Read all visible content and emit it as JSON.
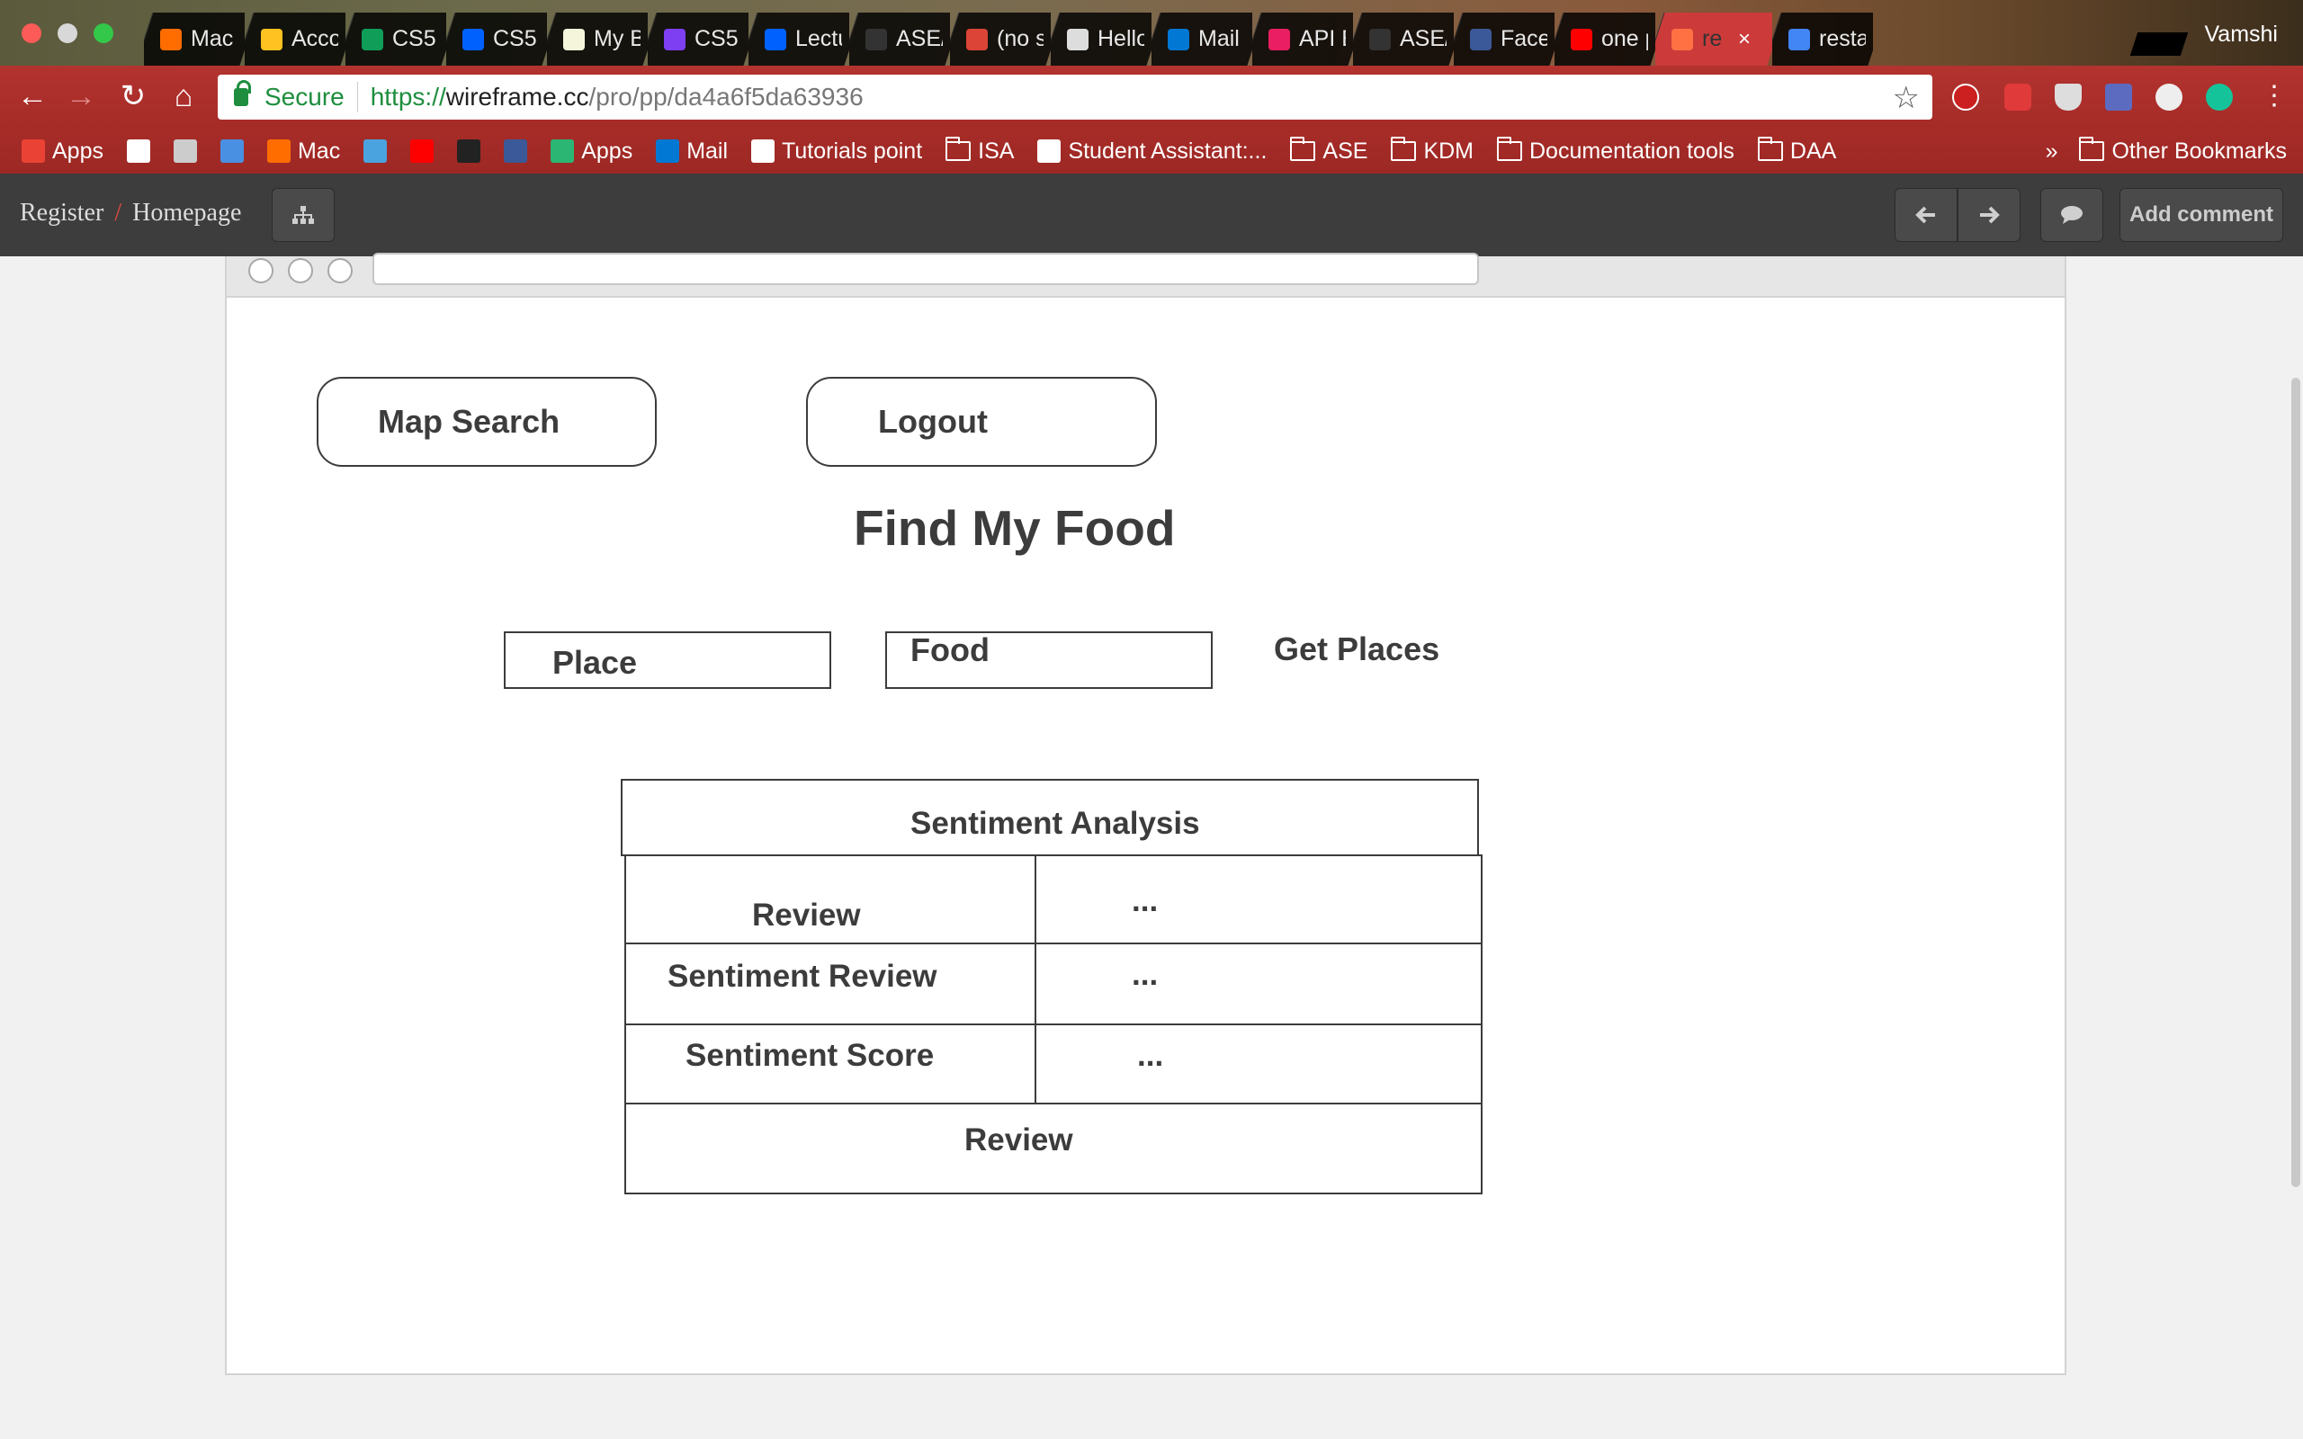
{
  "browser": {
    "tabs": [
      {
        "label": "Mac",
        "color": "#ff6d00"
      },
      {
        "label": "Acco",
        "color": "#ffc220"
      },
      {
        "label": "CS5",
        "color": "#0f9d58"
      },
      {
        "label": "CS5",
        "color": "#0061fe"
      },
      {
        "label": "My B",
        "color": "#f5f5dc"
      },
      {
        "label": "CS5",
        "color": "#7e3ff2"
      },
      {
        "label": "Lectu",
        "color": "#0061fe"
      },
      {
        "label": "ASE/",
        "color": "#333333"
      },
      {
        "label": "(no s",
        "color": "#db4437"
      },
      {
        "label": "Hello",
        "color": "#dddddd"
      },
      {
        "label": "Mail",
        "color": "#0078d4"
      },
      {
        "label": "API E",
        "color": "#e91e63"
      },
      {
        "label": "ASE/",
        "color": "#333333"
      },
      {
        "label": "Face",
        "color": "#3b5998"
      },
      {
        "label": "one p",
        "color": "#ff0000"
      },
      {
        "label": "re",
        "color": "#ff7043",
        "active": true
      },
      {
        "label": "resta",
        "color": "#4285f4"
      }
    ],
    "profile_name": "Vamshi",
    "secure_label": "Secure",
    "url": {
      "scheme": "https://",
      "host": "wireframe.cc",
      "path": "/pro/pp/da4a6f5da63936"
    },
    "bookmarks": [
      {
        "label": "Apps",
        "kind": "apps-grid-icon",
        "color": "#ea4335"
      },
      {
        "label": "",
        "kind": "google-icon",
        "color": "#ffffff"
      },
      {
        "label": "",
        "kind": "drive-icon",
        "color": "#cccccc"
      },
      {
        "label": "",
        "kind": "bookmark-icon",
        "color": "#4a90e2"
      },
      {
        "label": "Mac",
        "kind": "mac-icon",
        "color": "#ff6d00"
      },
      {
        "label": "",
        "kind": "fox-icon",
        "color": "#4aa3df"
      },
      {
        "label": "",
        "kind": "youtube-icon",
        "color": "#ff0000"
      },
      {
        "label": "",
        "kind": "blackboard-icon",
        "color": "#222222"
      },
      {
        "label": "",
        "kind": "facebook-icon",
        "color": "#3b5998"
      },
      {
        "label": "Apps",
        "kind": "apps-icon",
        "color": "#2bb673"
      },
      {
        "label": "Mail",
        "kind": "mail-icon",
        "color": "#0078d4"
      },
      {
        "label": "Tutorials point",
        "kind": "tutorials-icon",
        "color": "#ffffff"
      },
      {
        "label": "ISA",
        "kind": "folder-icon"
      },
      {
        "label": "Student Assistant:...",
        "kind": "page-icon",
        "color": "#ffffff"
      },
      {
        "label": "ASE",
        "kind": "folder-icon"
      },
      {
        "label": "KDM",
        "kind": "folder-icon"
      },
      {
        "label": "Documentation tools",
        "kind": "folder-icon"
      },
      {
        "label": "DAA",
        "kind": "folder-icon"
      }
    ],
    "overflow_label": "»",
    "other_bookmarks": "Other Bookmarks"
  },
  "wireframe_bar": {
    "breadcrumb": [
      "Register",
      "Homepage"
    ],
    "breadcrumb_sep": "/",
    "add_comment_label": "Add comment"
  },
  "page": {
    "map_search_label": "Map Search",
    "logout_label": "Logout",
    "title": "Find My Food",
    "place_value": "Place",
    "food_value": "Food",
    "get_places_label": "Get Places",
    "table": {
      "header": "Sentiment Analysis",
      "rows": [
        {
          "label": "Review",
          "value": "..."
        },
        {
          "label": "Sentiment Review",
          "value": "..."
        },
        {
          "label": "Sentiment Score",
          "value": "..."
        }
      ],
      "footer": "Review"
    }
  }
}
